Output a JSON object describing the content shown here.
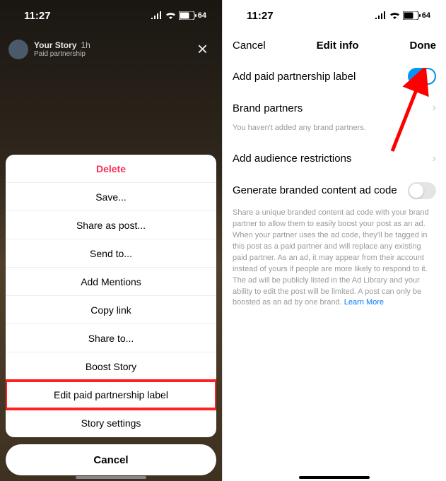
{
  "left": {
    "status": {
      "time": "11:27",
      "battery": "64"
    },
    "story": {
      "title": "Your Story",
      "time": "1h",
      "subtitle": "Paid partnership"
    },
    "sheet": {
      "items": [
        {
          "label": "Delete",
          "kind": "destructive"
        },
        {
          "label": "Save..."
        },
        {
          "label": "Share as post..."
        },
        {
          "label": "Send to..."
        },
        {
          "label": "Add Mentions"
        },
        {
          "label": "Copy link"
        },
        {
          "label": "Share to..."
        },
        {
          "label": "Boost Story"
        },
        {
          "label": "Edit paid partnership label",
          "highlighted": true
        },
        {
          "label": "Story settings"
        }
      ],
      "cancel": "Cancel"
    }
  },
  "right": {
    "status": {
      "time": "11:27",
      "battery": "64"
    },
    "nav": {
      "cancel": "Cancel",
      "title": "Edit info",
      "done": "Done"
    },
    "settings": {
      "paidLabel": {
        "label": "Add paid partnership label",
        "on": true
      },
      "brandPartners": {
        "label": "Brand partners",
        "helper": "You haven't added any brand partners."
      },
      "audience": {
        "label": "Add audience restrictions"
      },
      "adCode": {
        "label": "Generate branded content ad code",
        "on": false,
        "helper": "Share a unique branded content ad code with your brand partner to allow them to easily boost your post as an ad. When your partner uses the ad code, they'll be tagged in this post as a paid partner and will replace any existing paid partner. As an ad, it may appear from their account instead of yours if people are more likely to respond to it. The ad will be publicly listed in the Ad Library and your ability to edit the post will be limited. A post can only be boosted as an ad by one brand.",
        "learnMore": "Learn More"
      }
    }
  }
}
